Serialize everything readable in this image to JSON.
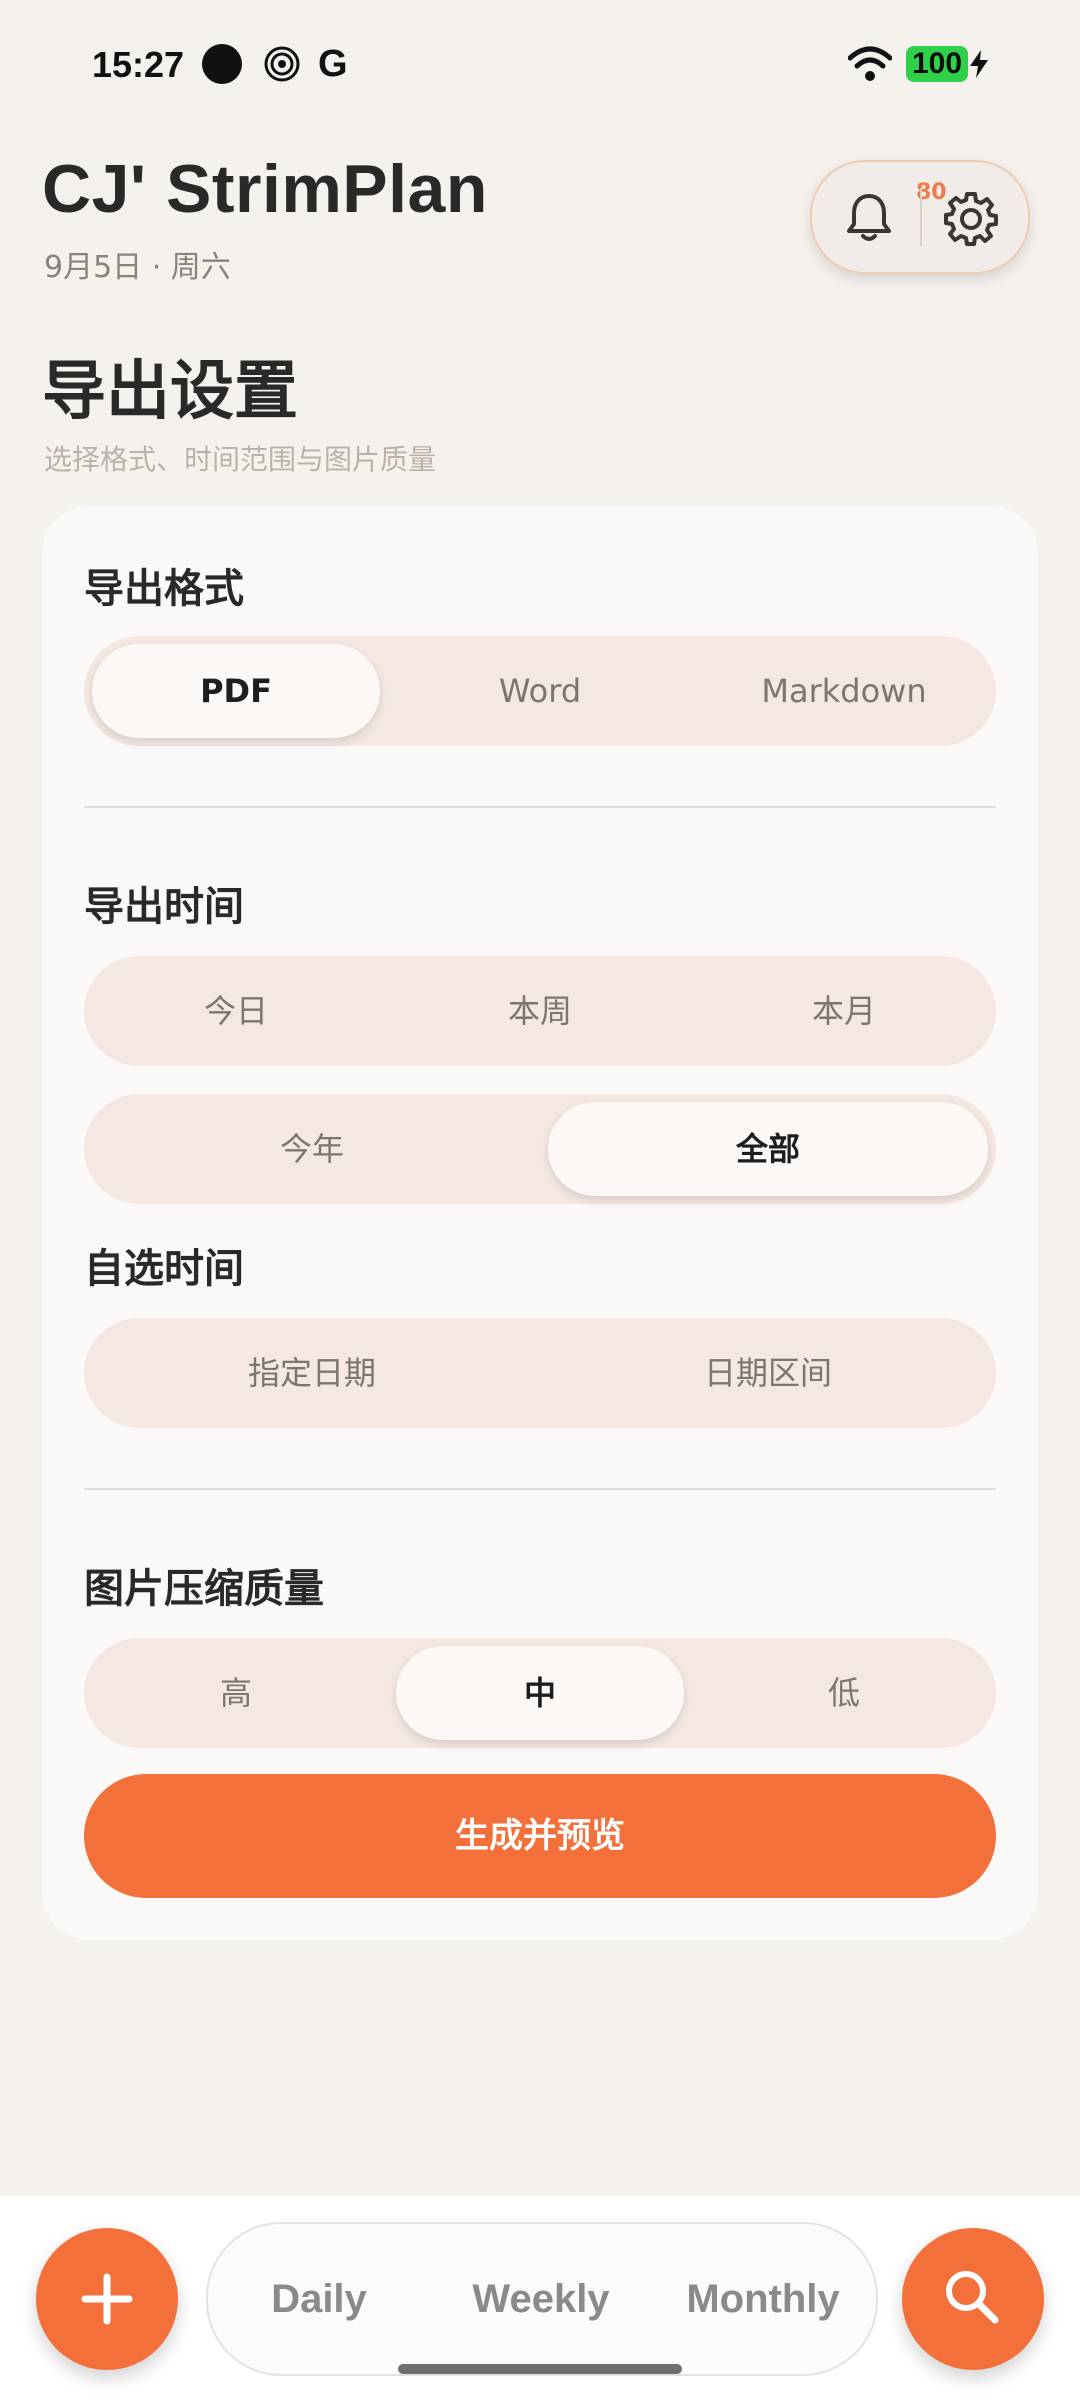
{
  "status_bar": {
    "time": "15:27",
    "google_glyph": "G",
    "battery": "100",
    "icons": [
      "black-dot-icon",
      "spiral-icon",
      "google-icon",
      "wifi-icon",
      "battery-icon",
      "charging-bolt-icon"
    ]
  },
  "header": {
    "app_title": "CJ' StrimPlan",
    "date": "9月5日 · 周六",
    "notification_count": "80"
  },
  "page": {
    "title": "导出设置",
    "subtitle": "选择格式、时间范围与图片质量"
  },
  "format": {
    "title": "导出格式",
    "options": [
      "PDF",
      "Word",
      "Markdown"
    ],
    "selected": "PDF"
  },
  "time": {
    "title": "导出时间",
    "row1": [
      "今日",
      "本周",
      "本月"
    ],
    "row2": [
      "今年",
      "全部"
    ],
    "selected": "全部"
  },
  "custom_time": {
    "title": "自选时间",
    "options": [
      "指定日期",
      "日期区间"
    ]
  },
  "quality": {
    "title": "图片压缩质量",
    "options": [
      "高",
      "中",
      "低"
    ],
    "selected": "中"
  },
  "actions": {
    "generate_label": "生成并预览"
  },
  "bottom_nav": {
    "items": [
      "Daily",
      "Weekly",
      "Monthly"
    ]
  },
  "colors": {
    "accent": "#f3703a",
    "background": "#f5f2ee",
    "segment_bg": "#f5e8e2",
    "battery_green": "#2fd14a"
  }
}
